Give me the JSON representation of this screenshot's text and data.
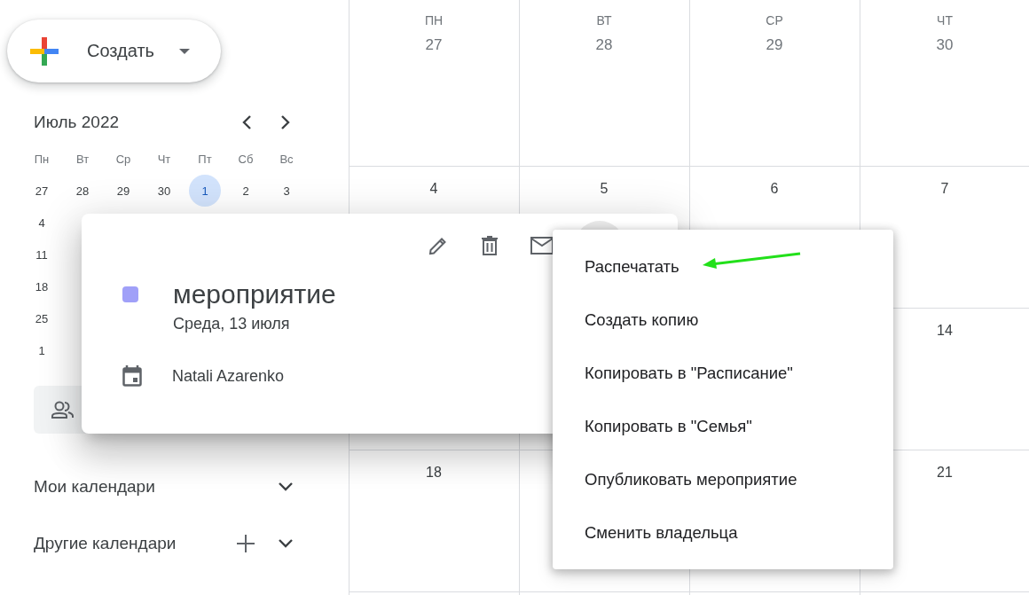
{
  "sidebar": {
    "create_button": {
      "label": "Создать"
    },
    "mini_calendar": {
      "title": "Июль 2022",
      "weekdays": [
        "Пн",
        "Вт",
        "Ср",
        "Чт",
        "Пт",
        "Сб",
        "Вс"
      ],
      "weeks": [
        [
          {
            "date": "27",
            "selected": false
          },
          {
            "date": "28",
            "selected": false
          },
          {
            "date": "29",
            "selected": false
          },
          {
            "date": "30",
            "selected": false
          },
          {
            "date": "1",
            "selected": true
          },
          {
            "date": "2",
            "selected": false
          },
          {
            "date": "3",
            "selected": false
          }
        ],
        [
          {
            "date": "4",
            "selected": false
          }
        ],
        [
          {
            "date": "11",
            "selected": false
          }
        ],
        [
          {
            "date": "18",
            "selected": false
          }
        ],
        [
          {
            "date": "25",
            "selected": false
          }
        ],
        [
          {
            "date": "1",
            "selected": false
          }
        ]
      ]
    },
    "sections": [
      {
        "label": "Мои календари",
        "can_add": false
      },
      {
        "label": "Другие календари",
        "can_add": true
      }
    ]
  },
  "calendar": {
    "header": [
      {
        "weekday": "ПН",
        "date": "27"
      },
      {
        "weekday": "ВТ",
        "date": "28"
      },
      {
        "weekday": "СР",
        "date": "29"
      },
      {
        "weekday": "ЧТ",
        "date": "30"
      }
    ],
    "weeks": [
      [
        {
          "kind": "date",
          "date": "4"
        },
        {
          "kind": "date",
          "date": "5"
        },
        {
          "kind": "date",
          "date": "6"
        },
        {
          "kind": "date",
          "date": "7"
        }
      ],
      [
        {
          "kind": "hidden"
        },
        {
          "kind": "hidden"
        },
        {
          "kind": "hidden"
        },
        {
          "kind": "date",
          "date": "14"
        }
      ],
      [
        {
          "kind": "date",
          "date": "18"
        },
        {
          "kind": "hidden"
        },
        {
          "kind": "hidden"
        },
        {
          "kind": "date",
          "date": "21"
        }
      ]
    ]
  },
  "event_popup": {
    "title": "мероприятие",
    "color": "#a0a0f8",
    "date": "Среда, 13 июля",
    "calendar": "Natali Azarenko"
  },
  "menu": {
    "items": [
      "Распечатать",
      "Создать копию",
      "Копировать в \"Расписание\"",
      "Копировать в \"Семья\"",
      "Опубликовать мероприятие",
      "Сменить владельца"
    ]
  }
}
